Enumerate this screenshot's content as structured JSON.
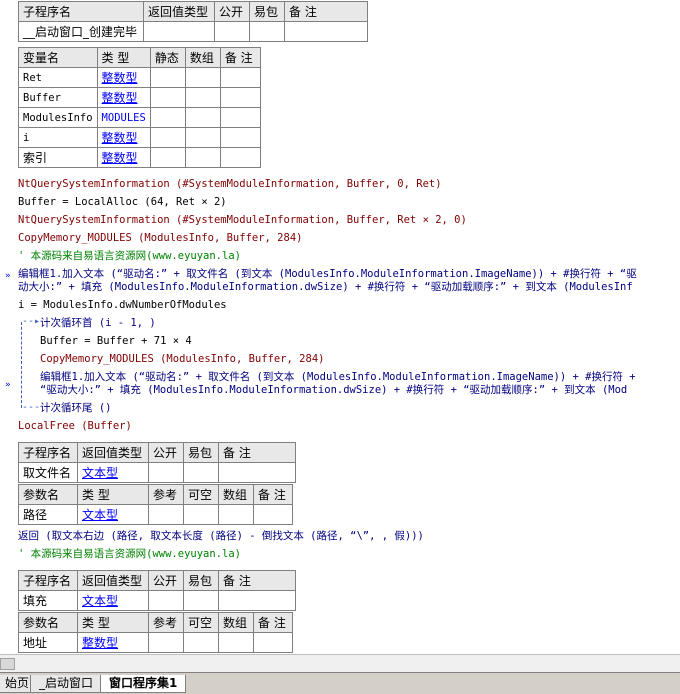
{
  "sub1": {
    "header": [
      "子程序名",
      "返回值类型",
      "公开",
      "易包",
      "备 注"
    ],
    "name": "__启动窗口_创建完毕"
  },
  "vars": {
    "header": [
      "变量名",
      "类 型",
      "静态",
      "数组",
      "备 注"
    ],
    "rows": [
      {
        "name": "Ret",
        "type": "整数型"
      },
      {
        "name": "Buffer",
        "type": "整数型"
      },
      {
        "name": "ModulesInfo",
        "type": "MODULES"
      },
      {
        "name": "i",
        "type": "整数型"
      },
      {
        "name": "索引",
        "type": "整数型"
      }
    ]
  },
  "code": {
    "l1": "NtQuerySystemInformation (#SystemModuleInformation, Buffer, 0, Ret)",
    "l2": "Buffer = LocalAlloc (64, Ret × 2)",
    "l3": "NtQuerySystemInformation (#SystemModuleInformation, Buffer, Ret × 2, 0)",
    "l4": "CopyMemory_MODULES (ModulesInfo, Buffer, 284)",
    "l5": "' 本源码来自易语言资源网(www.eyuyan.la)",
    "l6a": "编辑框1.加入文本 (“驱动名:” + 取文件名 (到文本 (ModulesInfo.ModuleInformation.ImageName)) + #换行符 + “驱",
    "l6b": "动大小:” + 填充 (ModulesInfo.ModuleInformation.dwSize) + #换行符 + “驱动加载顺序:” + 到文本 (ModulesInf",
    "l7": "i = ModulesInfo.dwNumberOfModules",
    "l8": "计次循环首 (i - 1, )",
    "l9": "Buffer = Buffer + 71 × 4",
    "l10": "CopyMemory_MODULES (ModulesInfo, Buffer, 284)",
    "l11a": "编辑框1.加入文本 (“驱动名:” + 取文件名 (到文本 (ModulesInfo.ModuleInformation.ImageName)) + #换行符 +",
    "l11b": "“驱动大小:” + 填充 (ModulesInfo.ModuleInformation.dwSize) + #换行符 + “驱动加载顺序:” + 到文本 (Mod",
    "l12": "计次循环尾 ()",
    "l13": "LocalFree (Buffer)",
    "l14": "返回 (取文本右边 (路径, 取文本长度 (路径) - 倒找文本 (路径, “\\”, , 假)))",
    "l15": "' 本源码来自易语言资源网(www.eyuyan.la)"
  },
  "sub2": {
    "header": [
      "子程序名",
      "返回值类型",
      "公开",
      "易包",
      "备 注"
    ],
    "name": "取文件名",
    "ret": "文本型",
    "param_header": [
      "参数名",
      "类 型",
      "参考",
      "可空",
      "数组",
      "备 注"
    ],
    "param_name": "路径",
    "param_type": "文本型"
  },
  "sub3": {
    "header": [
      "子程序名",
      "返回值类型",
      "公开",
      "易包",
      "备 注"
    ],
    "name": "填充",
    "ret": "文本型",
    "param_header": [
      "参数名",
      "类 型",
      "参考",
      "可空",
      "数组",
      "备 注"
    ],
    "param_name": "地址",
    "param_type": "整数型"
  },
  "tabs": [
    "始页",
    "_启动窗口",
    "窗口程序集1"
  ],
  "colors": {
    "keyword": "#000080",
    "function": "#800000",
    "string": "#0000c0",
    "comment": "#008000",
    "type_link": "#0000ff"
  }
}
